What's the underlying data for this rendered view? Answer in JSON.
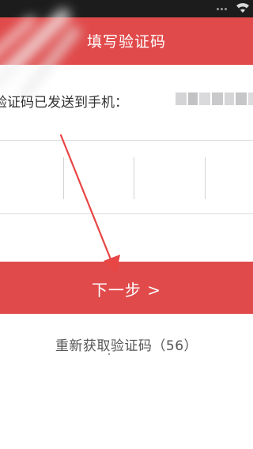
{
  "header": {
    "title": "填写验证码"
  },
  "message": {
    "sent_prefix": "验证码已发送到手机："
  },
  "code_input": {
    "cells": [
      "",
      "",
      "",
      ""
    ]
  },
  "actions": {
    "next_label": "下一步 >",
    "resend_label": "重新获取验证码（56）"
  },
  "colors": {
    "accent": "#e04a4b",
    "status_bar": "#1c1c1c",
    "annotation_arrow": "#e84545"
  },
  "icons": {
    "wifi": "wifi-icon"
  }
}
